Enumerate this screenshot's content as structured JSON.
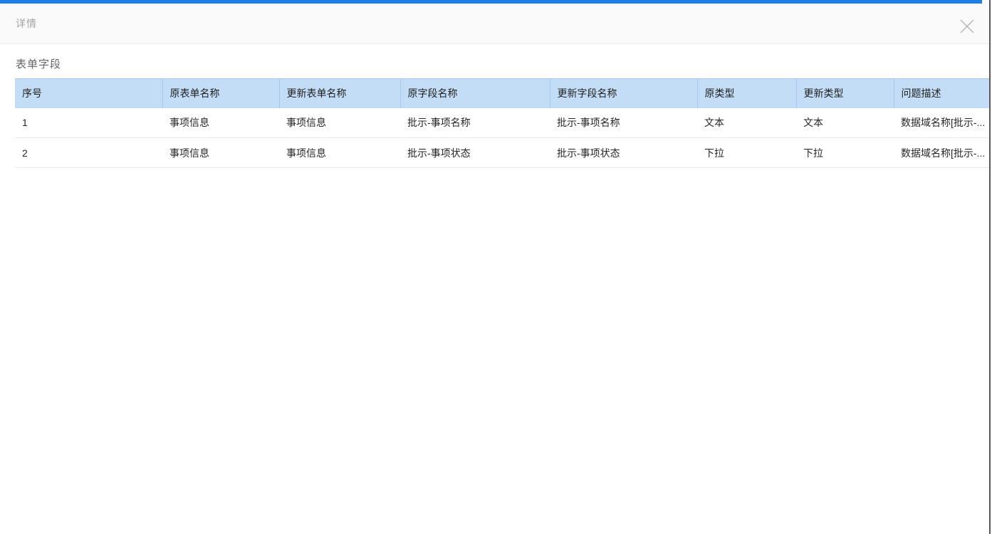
{
  "colors": {
    "accent_bar": "#1d80e8",
    "table_header_bg": "#c3ddf6",
    "table_header_border": "#a6c9eb",
    "right_edge_line": "#58585c"
  },
  "dialog": {
    "title": "详情",
    "close_icon": "close-x"
  },
  "section": {
    "title": "表单字段"
  },
  "table": {
    "columns": [
      "序号",
      "原表单名称",
      "更新表单名称",
      "原字段名称",
      "更新字段名称",
      "原类型",
      "更新类型",
      "问题描述"
    ],
    "rows": [
      [
        "1",
        "事项信息",
        "事项信息",
        "批示-事项名称",
        "批示-事项名称",
        "文本",
        "文本",
        "数据域名称[批示-..."
      ],
      [
        "2",
        "事项信息",
        "事项信息",
        "批示-事项状态",
        "批示-事项状态",
        "下拉",
        "下拉",
        "数据域名称[批示-..."
      ]
    ]
  }
}
